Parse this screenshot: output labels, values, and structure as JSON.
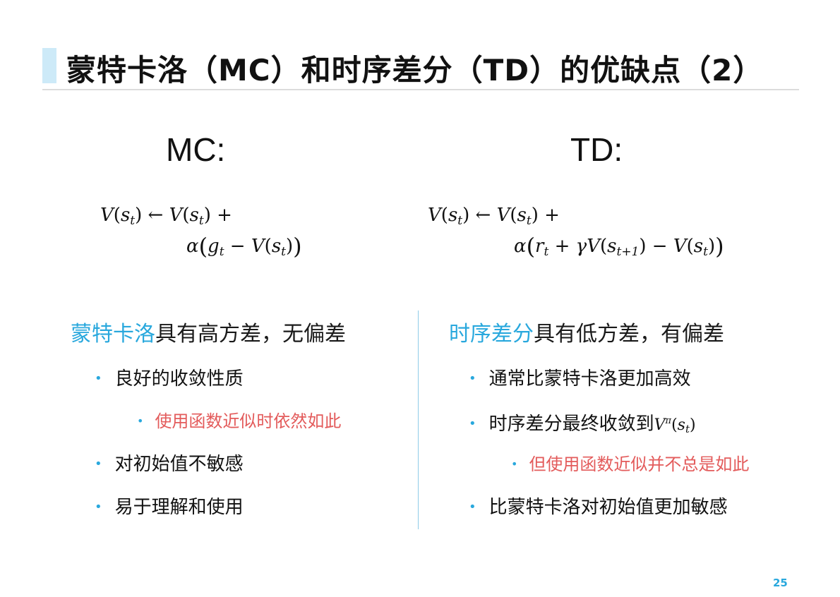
{
  "title": "蒙特卡洛（MC）和时序差分（TD）的优缺点（2）",
  "mc": {
    "heading": "MC:",
    "formula_line1": {
      "lhs": "V(",
      "s": "s",
      "t": "t",
      "arrow": ") ← V(",
      "end": ") +"
    },
    "formula_line2": {
      "alpha": "α",
      "g": "g",
      "t": "t",
      "minus": " − V(",
      "s": "s",
      "t2": "t",
      "close": ")"
    },
    "summary_highlight": "蒙特卡洛",
    "summary_rest": "具有高方差，无偏差",
    "bullets": [
      "良好的收敛性质",
      "使用函数近似时依然如此",
      "对初始值不敏感",
      "易于理解和使用"
    ]
  },
  "td": {
    "heading": "TD:",
    "summary_highlight": "时序差分",
    "summary_rest": "具有低方差，有偏差",
    "bullets": [
      "通常比蒙特卡洛更加高效",
      "时序差分最终收敛到",
      "但使用函数近似并不总是如此",
      "比蒙特卡洛对初始值更加敏感"
    ]
  },
  "bullet_glyph": "•",
  "page_number": "25",
  "colors": {
    "accent": "#29a8dd",
    "highlight_red": "#e35b5b",
    "title_block": "#cdeaf8"
  }
}
